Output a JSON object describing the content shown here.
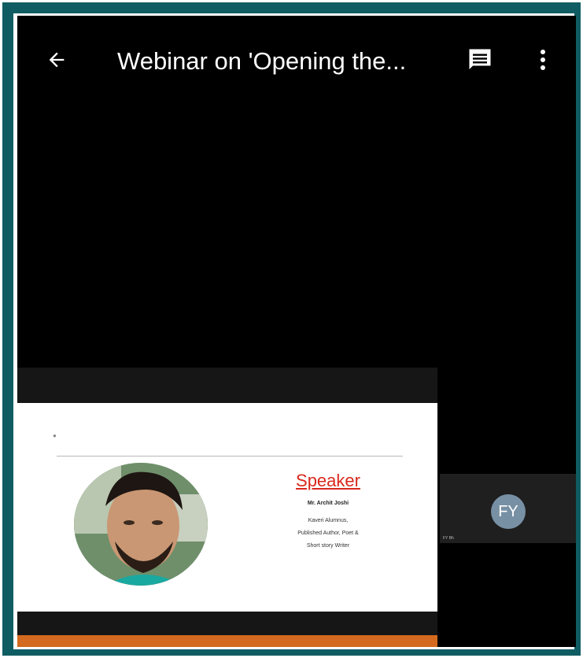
{
  "header": {
    "title": "Webinar on 'Opening the...",
    "back_icon": "arrow-back-icon",
    "chat_icon": "chat-icon",
    "more_icon": "more-vert-icon"
  },
  "slide": {
    "heading": "Speaker",
    "name": "Mr. Archit Joshi",
    "lines": [
      "Kaveri Alumnus,",
      "Published Author, Poet &",
      "Short story Writer"
    ],
    "accent_color": "#d36a1f",
    "heading_color": "#d9281c"
  },
  "participant": {
    "initials": "FY",
    "name": "FY Bh"
  }
}
